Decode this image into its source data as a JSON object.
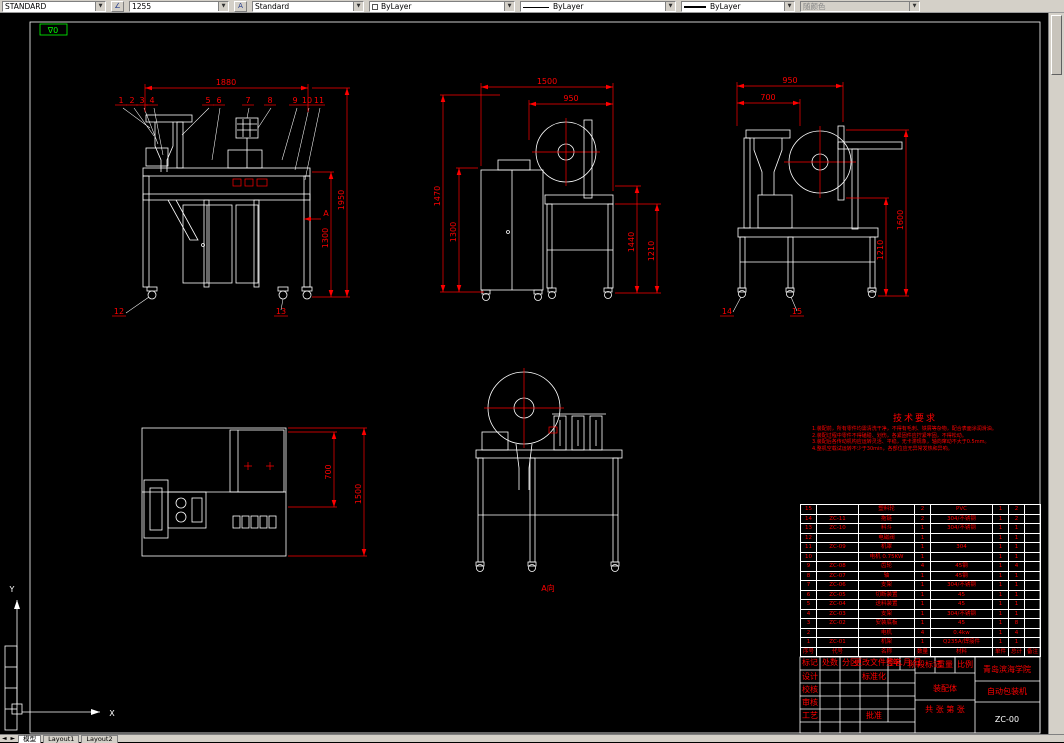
{
  "toolbar": {
    "style1": "STANDARD",
    "dim_style": "1255",
    "text_style": "Standard",
    "color": "ByLayer",
    "linetype": "ByLayer",
    "lineweight": "ByLayer",
    "plot_style": "随颜色"
  },
  "canvas_marker": "∇0",
  "ucs": {
    "x_label": "X",
    "y_label": "Y"
  },
  "tabs": {
    "model": "模型",
    "layout1": "Layout1",
    "layout2": "Layout2"
  },
  "views": {
    "front": {
      "dim_width": "1880",
      "dim_height_total": "1950",
      "dim_height_frame": "1300",
      "callouts_top": [
        "1",
        "2",
        "3",
        "4",
        "5",
        "6",
        "7",
        "8",
        "9",
        "10",
        "11"
      ],
      "callout_12": "12",
      "callout_13": "13",
      "section_label": "A"
    },
    "side": {
      "dim_w_total": "1500",
      "dim_w_reel": "950",
      "dim_h_left_outer": "1470",
      "dim_h_left_inner": "1300",
      "dim_h_right_inner": "1440",
      "dim_h_right_outer": "1210"
    },
    "right": {
      "dim_w_outer": "950",
      "dim_w_inner": "700",
      "dim_h_outer": "1600",
      "dim_h_inner": "1210",
      "callout_14": "14",
      "callout_15": "15"
    },
    "plan": {
      "dim_h_inner": "700",
      "dim_h_outer": "1500"
    },
    "a_view": {
      "label": "A向"
    }
  },
  "tech_req": {
    "title": "技术要求",
    "lines": [
      "1.装配前，所有零件均需清洗干净，不得有毛刺、铁屑等杂物，配合表面涂润滑油。",
      "2.装配过程中零件不得磕碰、划伤，各紧固件应拧紧牢固，不得松动。",
      "3.装配后各传动机构应运转灵活、平稳，无卡滞现象，轴向窜动不大于0.5mm。",
      "4.整机空载试运转不少于30min，各部位应无异常发热和异响。"
    ]
  },
  "bom": {
    "header": [
      "序号",
      "代号",
      "名称",
      "数量",
      "材料",
      "单件",
      "总计",
      "备注"
    ],
    "rows": [
      [
        "15",
        "",
        "塑料轮",
        "2",
        "PVC",
        "1",
        "2",
        ""
      ],
      [
        "14",
        "ZC-11",
        "拖链",
        "2",
        "304/不锈钢",
        "1",
        "2",
        ""
      ],
      [
        "13",
        "ZC-10",
        "料斗",
        "1",
        "304/不锈钢",
        "1",
        "1",
        ""
      ],
      [
        "12",
        "",
        "电磁阀",
        "1",
        "",
        "1",
        "1",
        ""
      ],
      [
        "11",
        "ZC-09",
        "机罩",
        "1",
        "304",
        "1",
        "1",
        ""
      ],
      [
        "10",
        "",
        "电机 0.75KW",
        "1",
        "",
        "1",
        "1",
        ""
      ],
      [
        "9",
        "ZC-08",
        "齿轮",
        "4",
        "45钢",
        "1",
        "4",
        ""
      ],
      [
        "8",
        "ZC-07",
        "轴",
        "1",
        "45钢",
        "1",
        "1",
        ""
      ],
      [
        "7",
        "ZC-06",
        "支架",
        "1",
        "304/不锈钢",
        "1",
        "1",
        ""
      ],
      [
        "6",
        "ZC-05",
        "切断装置",
        "1",
        "45",
        "1",
        "1",
        ""
      ],
      [
        "5",
        "ZC-04",
        "送料装置",
        "1",
        "45",
        "1",
        "1",
        ""
      ],
      [
        "4",
        "ZC-03",
        "支架",
        "1",
        "304/不锈钢",
        "1",
        "1",
        ""
      ],
      [
        "3",
        "ZC-02",
        "安装底板",
        "1",
        "45",
        "1",
        "8",
        ""
      ],
      [
        "2",
        "",
        "电机",
        "4",
        "0.4kw",
        "1",
        "4",
        ""
      ],
      [
        "1",
        "ZC-01",
        "机架",
        "1",
        "Q235A/焊接件",
        "1",
        "1",
        ""
      ]
    ]
  },
  "title_block": {
    "rev_row": [
      "标记",
      "处数",
      "分区",
      "更改文件号",
      "签名",
      "年.月.日"
    ],
    "roles": [
      "设计",
      "校核",
      "审核",
      "工艺"
    ],
    "standard_label": "标准化",
    "approve_label": "批准",
    "stage_labels": [
      "阶段标记",
      "重量",
      "比例"
    ],
    "sheet_label": "共 张 第 张",
    "part_title": "装配体",
    "org": "青岛滨海学院",
    "product": "自动包装机",
    "drawing_no": "ZC-00"
  }
}
